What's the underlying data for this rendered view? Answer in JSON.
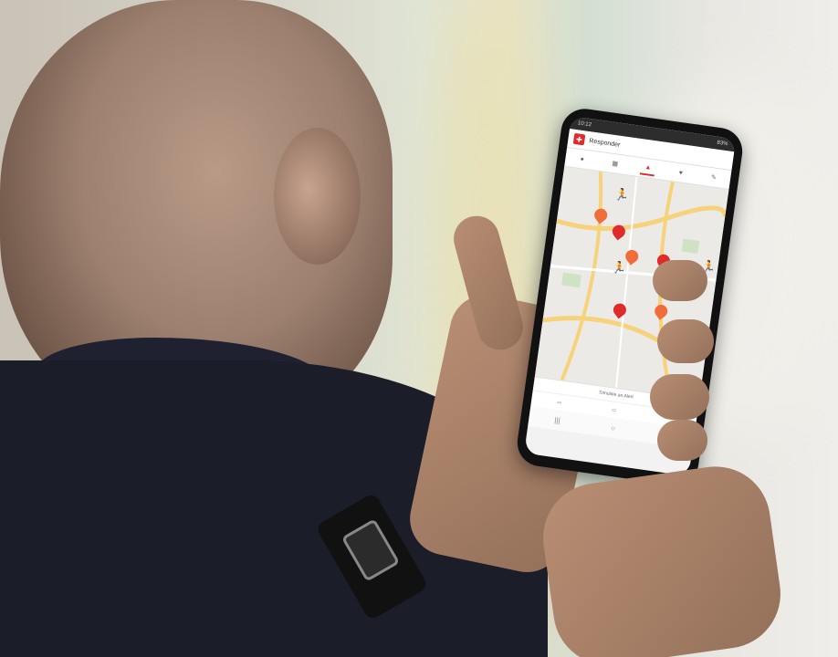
{
  "phone": {
    "status": {
      "time": "10:12",
      "battery": "83%"
    },
    "app": {
      "title": "Responder",
      "logo_icon": "responder-logo-icon"
    },
    "tabs": [
      {
        "icon": "person-icon",
        "active": false
      },
      {
        "icon": "building-icon",
        "active": false
      },
      {
        "icon": "alert-icon",
        "active": true
      },
      {
        "icon": "heart-icon",
        "active": false
      },
      {
        "icon": "edit-icon",
        "active": false
      }
    ],
    "map": {
      "markers": [
        {
          "type": "aed",
          "color": "#f26b3a"
        },
        {
          "type": "aed",
          "color": "#e02b2b"
        },
        {
          "type": "aed",
          "color": "#f26b3a"
        },
        {
          "type": "aed",
          "color": "#e02b2b"
        },
        {
          "type": "aed",
          "color": "#e02b2b"
        },
        {
          "type": "aed",
          "color": "#f26b3a"
        },
        {
          "type": "responder",
          "color": "#e02b2b"
        },
        {
          "type": "responder",
          "color": "#e02b2b"
        },
        {
          "type": "responder",
          "color": "#3b9b3b"
        }
      ]
    },
    "bottom": {
      "simulate_label": "Simulate an Alert"
    }
  },
  "colors": {
    "accent": "#e02b2b",
    "map_road": "#f6d37a",
    "map_bg": "#eceae6"
  }
}
